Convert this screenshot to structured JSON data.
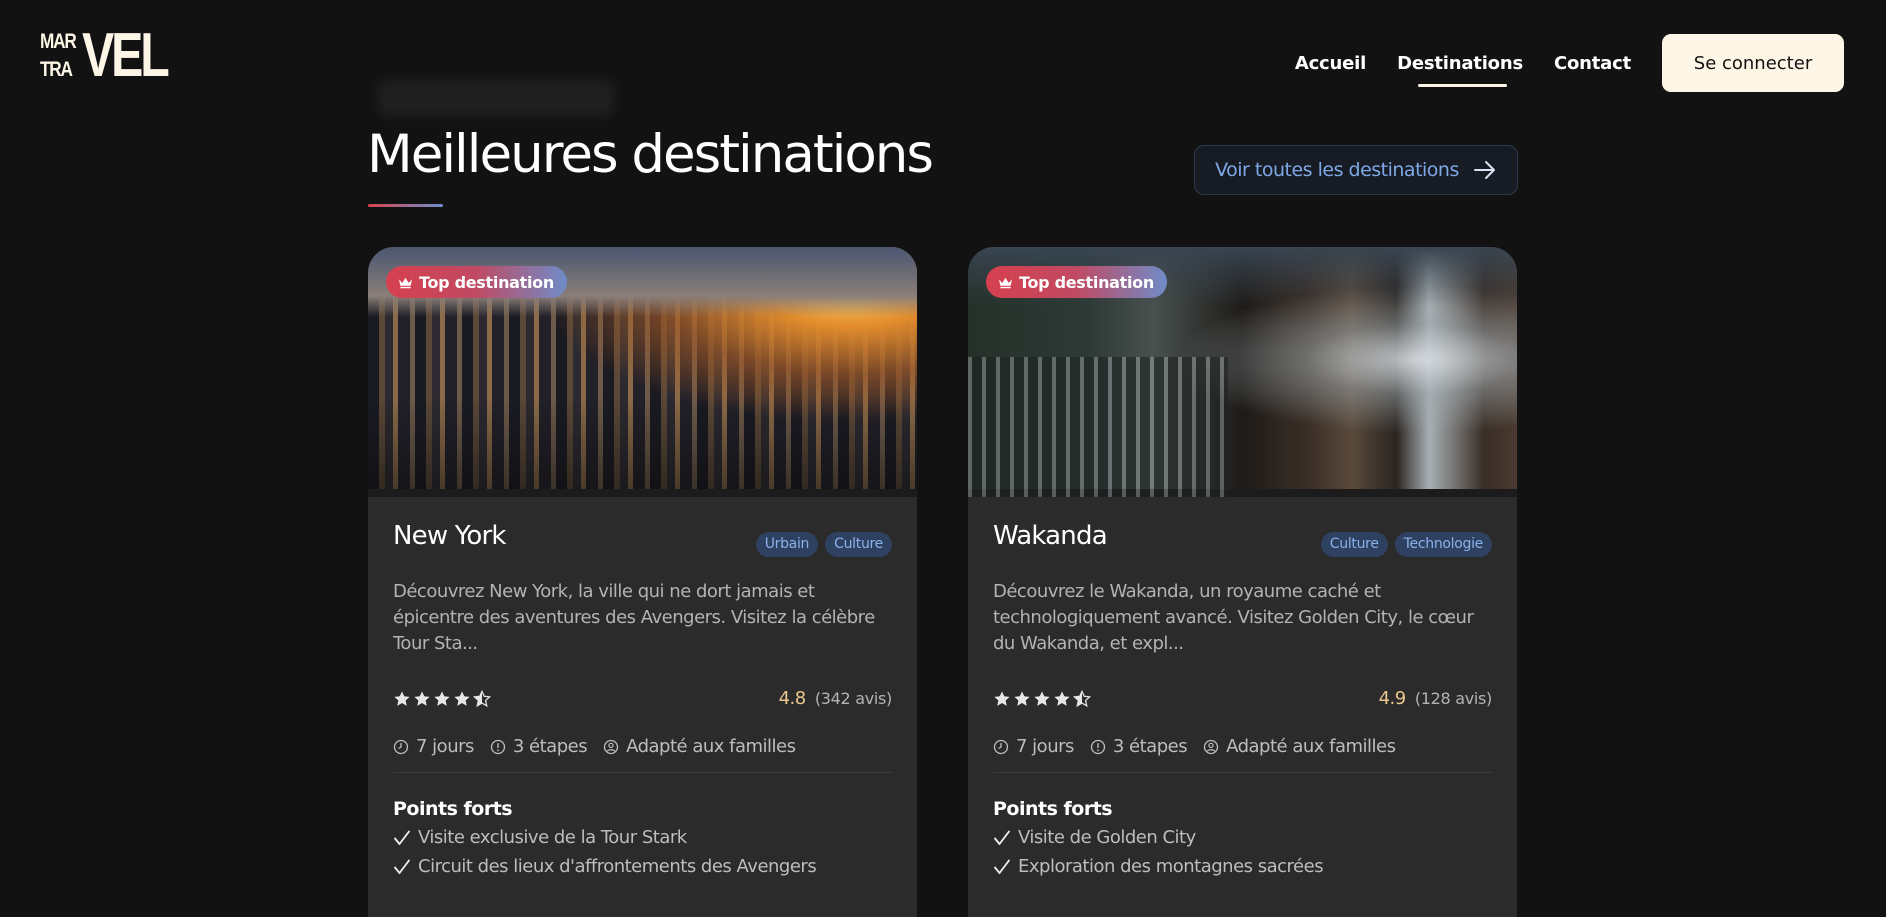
{
  "header": {
    "logo": {
      "small_top": "MAR",
      "small_bottom": "TRA",
      "big": "VEL"
    },
    "nav": [
      {
        "label": "Accueil"
      },
      {
        "label": "Destinations",
        "active": true
      },
      {
        "label": "Contact"
      }
    ],
    "login_label": "Se connecter"
  },
  "section": {
    "title": "Meilleures destinations",
    "see_all_label": "Voir toutes les destinations"
  },
  "colors": {
    "background": "#121212",
    "accent_cream": "#fdf6e7",
    "accent_blue": "#7fa8e6",
    "accent_red": "#d6404e",
    "rating_gold": "#e9c78e"
  },
  "cards": [
    {
      "badge": "Top destination",
      "title": "New York",
      "tags": [
        "Urbain",
        "Culture"
      ],
      "description": "Découvrez New York, la ville qui ne dort jamais et épicentre des aventures des Avengers. Visitez la célèbre Tour Sta...",
      "stars": 4.5,
      "rating": "4.8",
      "reviews": "(342 avis)",
      "duration": "7 jours",
      "steps": "3 étapes",
      "family": "Adapté aux familles",
      "highlights_title": "Points forts",
      "highlights": [
        "Visite exclusive de la Tour Stark",
        "Circuit des lieux d'affrontements des Avengers"
      ]
    },
    {
      "badge": "Top destination",
      "title": "Wakanda",
      "tags": [
        "Culture",
        "Technologie"
      ],
      "description": "Découvrez le Wakanda, un royaume caché et technologiquement avancé. Visitez Golden City, le cœur du Wakanda, et expl...",
      "stars": 4.5,
      "rating": "4.9",
      "reviews": "(128 avis)",
      "duration": "7 jours",
      "steps": "3 étapes",
      "family": "Adapté aux familles",
      "highlights_title": "Points forts",
      "highlights": [
        "Visite de Golden City",
        "Exploration des montagnes sacrées"
      ]
    }
  ]
}
